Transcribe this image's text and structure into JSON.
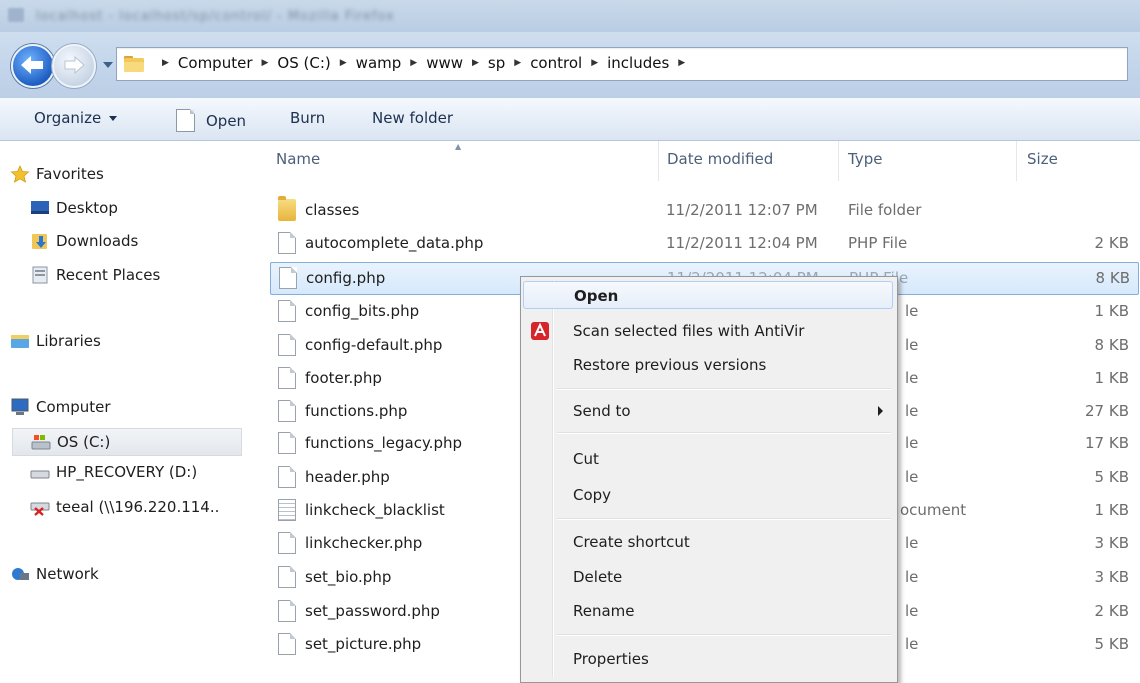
{
  "window": {
    "blurred_title": "localhost - localhost/sp/control/ - Mozilla Firefox"
  },
  "address_bar": {
    "crumbs": [
      "Computer",
      "OS (C:)",
      "wamp",
      "www",
      "sp",
      "control",
      "includes"
    ]
  },
  "toolbar": {
    "organize": "Organize",
    "open": "Open",
    "burn": "Burn",
    "new_folder": "New folder"
  },
  "nav": {
    "favorites": "Favorites",
    "desktop": "Desktop",
    "downloads": "Downloads",
    "recent": "Recent Places",
    "libraries": "Libraries",
    "computer": "Computer",
    "os_c": "OS (C:)",
    "hp_recovery": "HP_RECOVERY (D:)",
    "teeal": "teeal (\\\\196.220.114..",
    "network": "Network"
  },
  "columns": {
    "name": "Name",
    "date": "Date modified",
    "type": "Type",
    "size": "Size"
  },
  "files": [
    {
      "name": "classes",
      "date": "11/2/2011 12:07 PM",
      "type": "File folder",
      "size": "",
      "icon": "folder"
    },
    {
      "name": "autocomplete_data.php",
      "date": "11/2/2011 12:04 PM",
      "type": "PHP File",
      "size": "2 KB",
      "icon": "file"
    },
    {
      "name": "config.php",
      "date": "11/2/2011 12:04 PM",
      "type": "PHP File",
      "size": "8 KB",
      "icon": "file"
    },
    {
      "name": "config_bits.php",
      "date": "",
      "type": "le",
      "size": "1 KB",
      "icon": "file"
    },
    {
      "name": "config-default.php",
      "date": "",
      "type": "le",
      "size": "8 KB",
      "icon": "file"
    },
    {
      "name": "footer.php",
      "date": "",
      "type": "le",
      "size": "1 KB",
      "icon": "file"
    },
    {
      "name": "functions.php",
      "date": "",
      "type": "le",
      "size": "27 KB",
      "icon": "file"
    },
    {
      "name": "functions_legacy.php",
      "date": "",
      "type": "le",
      "size": "17 KB",
      "icon": "file"
    },
    {
      "name": "header.php",
      "date": "",
      "type": "le",
      "size": "5 KB",
      "icon": "file"
    },
    {
      "name": "linkcheck_blacklist",
      "date": "",
      "type": "ocument",
      "size": "1 KB",
      "icon": "text"
    },
    {
      "name": "linkchecker.php",
      "date": "",
      "type": "le",
      "size": "3 KB",
      "icon": "file"
    },
    {
      "name": "set_bio.php",
      "date": "",
      "type": "le",
      "size": "3 KB",
      "icon": "file"
    },
    {
      "name": "set_password.php",
      "date": "",
      "type": "le",
      "size": "2 KB",
      "icon": "file"
    },
    {
      "name": "set_picture.php",
      "date": "",
      "type": "le",
      "size": "5 KB",
      "icon": "file"
    }
  ],
  "context_menu": {
    "open": "Open",
    "scan": "Scan selected files with AntiVir",
    "restore": "Restore previous versions",
    "send_to": "Send to",
    "cut": "Cut",
    "copy": "Copy",
    "create_shortcut": "Create shortcut",
    "delete": "Delete",
    "rename": "Rename",
    "properties": "Properties"
  }
}
